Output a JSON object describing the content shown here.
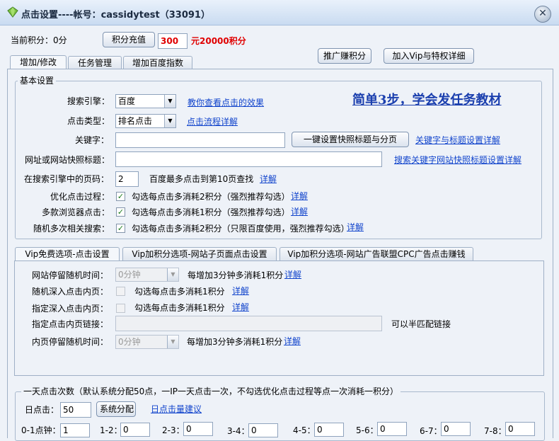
{
  "window": {
    "title": "点击设置----帐号：cassidytest（33091）"
  },
  "header": {
    "points_label": "当前积分：0分",
    "recharge_button": "积分充值",
    "amount_value": "300",
    "amount_note": "元20000积分",
    "promote_button": "推广赚积分",
    "vip_button": "加入Vip与特权详细"
  },
  "tabs": [
    "增加/修改",
    "任务管理",
    "增加百度指数"
  ],
  "basic": {
    "group_title": "基本设置",
    "tutorial_link": "简单3步，学会发任务教材",
    "engine_label": "搜索引擎：",
    "engine_value": "百度",
    "engine_link": "教你查看点击的效果",
    "click_type_label": "点击类型：",
    "click_type_value": "排名点击",
    "click_type_link": "点击流程详解",
    "keyword_label": "关键字：",
    "keyword_value": "",
    "set_snapshot_button": "一键设置快照标题与分页",
    "keyword_link": "关键字与标题设置详解",
    "url_label": "网址或网站快照标题：",
    "url_value": "",
    "url_link": "搜索关键字网站快照标题设置详解",
    "page_label": "在搜索引擎中的页码：",
    "page_value": "2",
    "page_note": "百度最多点击到第10页查找",
    "page_link": "详解",
    "optimize_label": "优化点击过程：",
    "optimize_text": "勾选每点击多消耗2积分（强烈推荐勾选）",
    "optimize_link": "详解",
    "multi_browser_label": "多款浏览器点击：",
    "multi_browser_text": "勾选每点击多消耗1积分（强烈推荐勾选）",
    "multi_browser_link": "详解",
    "random_search_label": "随机多次相关搜索：",
    "random_search_text": "勾选每点击多消耗2积分（只限百度使用，强烈推荐勾选）",
    "random_search_link": "详解",
    "check_mark": "✓"
  },
  "vip_tabs": [
    "Vip免费选项-点击设置",
    "Vip加积分选项-网站子页面点击设置",
    "Vip加积分选项-网站广告联盟CPC广告点击赚钱"
  ],
  "vip": {
    "stay_label": "网站停留随机时间：",
    "stay_value": "0分钟",
    "stay_note": "每增加3分钟多消耗1积分",
    "stay_link": "详解",
    "random_deep_label": "随机深入点击内页：",
    "random_deep_text": "勾选每点击多消耗1积分",
    "random_deep_link": "详解",
    "specified_deep_label": "指定深入点击内页：",
    "specified_deep_text": "勾选每点击多消耗1积分",
    "specified_deep_link": "详解",
    "inner_link_label": "指定点击内页链接：",
    "inner_link_value": "",
    "inner_link_note": "可以半匹配链接",
    "inner_stay_label": "内页停留随机时间：",
    "inner_stay_value": "0分钟",
    "inner_stay_note": "每增加3分钟多消耗1积分",
    "inner_stay_link": "详解"
  },
  "daily": {
    "group_title": "一天点击次数（默认系统分配50点，一IP一天点击一次，不勾选优化点击过程等点一次消耗一积分）",
    "clicks_label": "日点击：",
    "clicks_value": "50",
    "auto_button": "系统分配",
    "suggest_link": "日点击量建议",
    "hours": [
      {
        "label": "0-1点钟：",
        "value": "1"
      },
      {
        "label": "1-2：",
        "value": "0"
      },
      {
        "label": "2-3：",
        "value": "0"
      },
      {
        "label": "3-4：",
        "value": "0"
      },
      {
        "label": "4-5：",
        "value": "0"
      },
      {
        "label": "5-6：",
        "value": "0"
      },
      {
        "label": "6-7：",
        "value": "0"
      },
      {
        "label": "7-8：",
        "value": "0"
      }
    ]
  },
  "colors": {
    "link": "#1144cc",
    "accent_red": "#e00000",
    "title_bar": "#c9dbf1"
  },
  "icons": {
    "app": "gem-icon",
    "close": "close-icon",
    "dropdown": "chevron-down-icon",
    "check": "check-icon"
  }
}
